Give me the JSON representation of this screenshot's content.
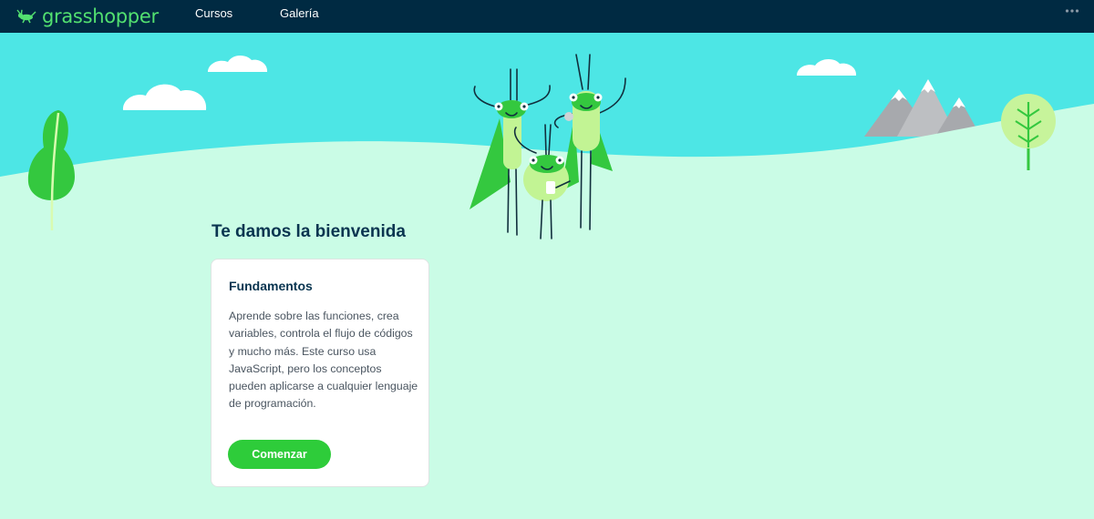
{
  "header": {
    "logo_text": "grasshopper",
    "nav": [
      {
        "label": "Cursos"
      },
      {
        "label": "Galería"
      }
    ],
    "more_icon": "ellipsis-icon"
  },
  "main": {
    "welcome_heading": "Te damos la bienvenida",
    "course_card": {
      "title": "Fundamentos",
      "description": "Aprende sobre las funciones, crea variables, controla el flujo de códigos y mucho más. Este curso usa JavaScript, pero los conceptos pueden aplicarse a cualquier lenguaje de programación.",
      "button_label": "Comenzar"
    }
  },
  "colors": {
    "header_bg": "#002a42",
    "sky": "#4de6e5",
    "ground": "#cafce6",
    "brand_green": "#2ecc3a",
    "heading": "#0a3550"
  }
}
